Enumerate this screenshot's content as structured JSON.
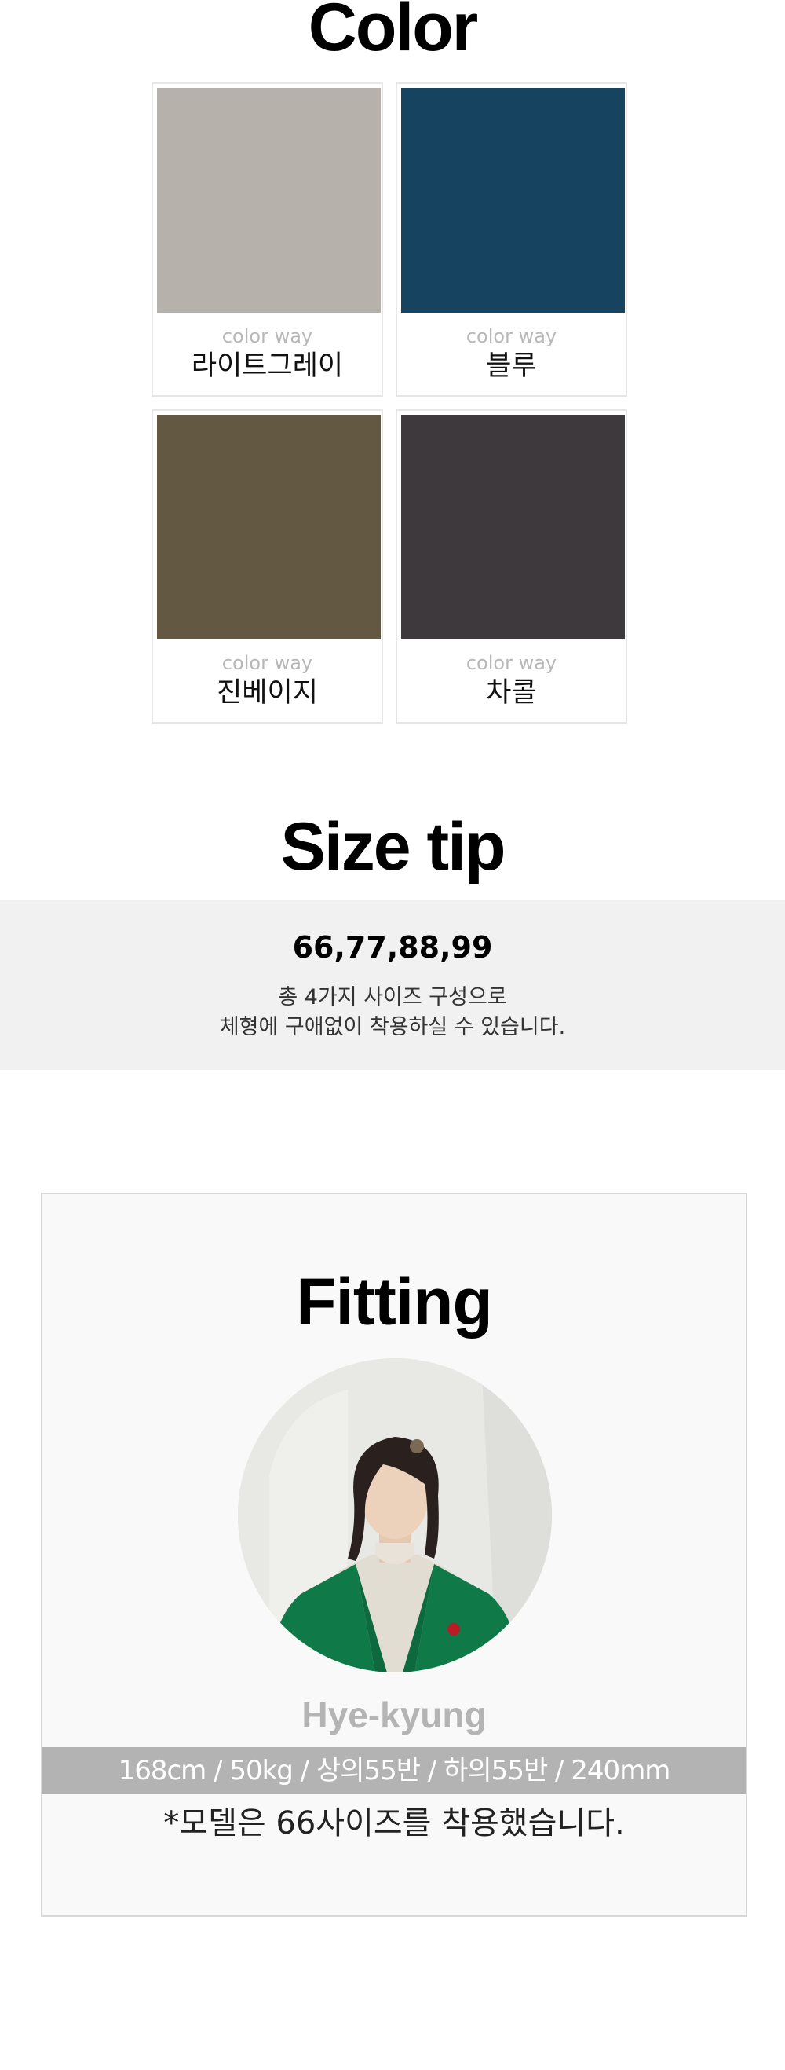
{
  "color_section": {
    "title": "Color",
    "swatches": [
      {
        "caption": "color way",
        "name": "라이트그레이",
        "color": "#b7b1ab"
      },
      {
        "caption": "color way",
        "name": "블루",
        "color": "#154360"
      },
      {
        "caption": "color way",
        "name": "진베이지",
        "color": "#635841"
      },
      {
        "caption": "color way",
        "name": "차콜",
        "color": "#3d393d"
      }
    ]
  },
  "size_section": {
    "title": "Size tip",
    "sizes": "66,77,88,99",
    "desc_line1": "총 4가지 사이즈 구성으로",
    "desc_line2": "체형에 구애없이 착용하실 수 있습니다."
  },
  "fitting_section": {
    "title": "Fitting",
    "model_name": "Hye-kyung",
    "stats": "168cm / 50kg / 상의55반 / 하의55반 / 240mm",
    "note": "*모델은 66사이즈를 착용했습니다."
  }
}
